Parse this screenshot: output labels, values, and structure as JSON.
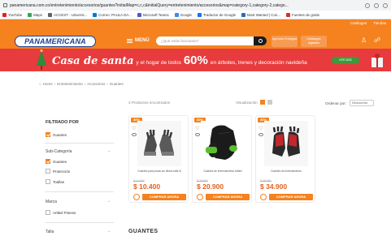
{
  "browser": {
    "url": "panamericana.com.co/entretenimiento/accesorios/guantes?initialMap=c,c,c&initialQuery=entretenimiento/accesorios&map=category-1,category-2,catego...",
    "bookmarks": [
      "YouTube",
      "Maps",
      "ACCEST - Universi...",
      "Correo: PAULA DA...",
      "Microsoft Teams",
      "Google",
      "Traductor de Google",
      "Most Wanted | Con...",
      "Fuentes de gratis"
    ]
  },
  "header": {
    "top_links": [
      "Catálogos",
      "Tiendas"
    ],
    "logo": "PANAMERICANA",
    "menu_label": "MENÚ",
    "search_placeholder": "¿Qué estás buscando?",
    "pill_1": "Agendar Entregas",
    "pill_2": "Catálogos digitales",
    "colors": {
      "brand": "#f5821f",
      "banner": "#e73b3d",
      "logo_blue": "#1e3f8a"
    }
  },
  "banner": {
    "title": "Casa de santa",
    "text_1": "y el hogar de todos",
    "discount": "60%",
    "text_2": "en árboles, trenes y decoración navideña",
    "cta": "VER MÁS"
  },
  "breadcrumb": [
    "Home",
    "Entretenimiento",
    "Accesorios",
    "Guantes"
  ],
  "sidebar": {
    "title": "FILTRADO POR",
    "active_filter": "Guantes",
    "subcategory_label": "Sub-Categoría",
    "subcategories": [
      {
        "label": "Guantes",
        "checked": true
      },
      {
        "label": "Protección",
        "checked": false
      },
      {
        "label": "Toallas",
        "checked": false
      }
    ],
    "brand_label": "Marca",
    "brands": [
      {
        "label": "Artikel Fitness",
        "checked": false
      }
    ],
    "size_label": "Talla"
  },
  "listing": {
    "count": "3 Productos encontrados",
    "view_label": "Visualización",
    "order_label": "Ordenar por:",
    "order_value": "Descuento"
  },
  "products": [
    {
      "badge": "30%",
      "name": "Guantes para pesas sin dedos talla M",
      "old_price": "$ 14.900",
      "price": "$ 10.400",
      "button": "COMPRAR AHORA"
    },
    {
      "badge": "30%",
      "name": "Guantes de entrenamiento Artikel",
      "old_price": "$ 29.900",
      "price": "$ 20.900",
      "button": "COMPRAR AHORA"
    },
    {
      "badge": "30%",
      "name": "Guantes de entrenamiento",
      "old_price": "$ 49.900",
      "price": "$ 34.900",
      "button": "COMPRAR AHORA"
    }
  ],
  "section_heading": "GUANTES"
}
